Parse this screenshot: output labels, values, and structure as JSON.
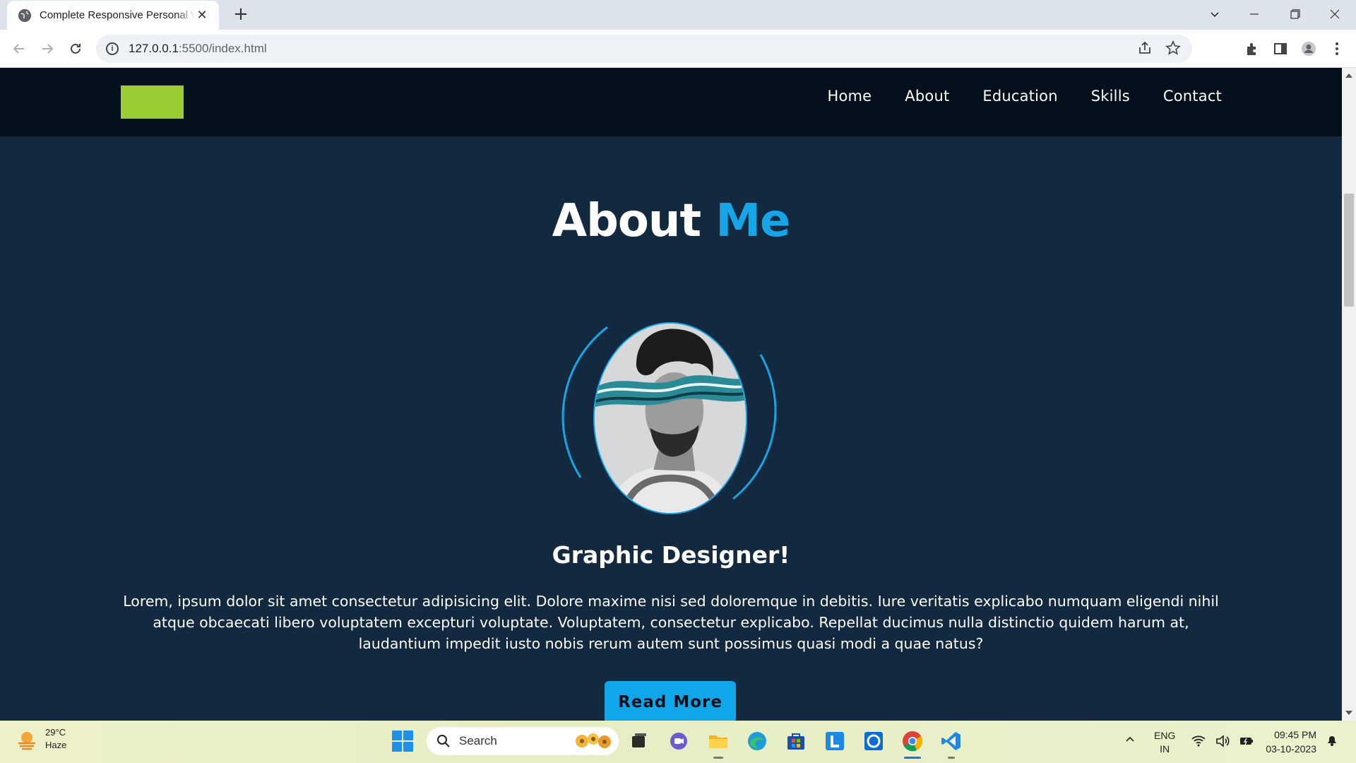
{
  "browser": {
    "tab_title": "Complete Responsive Personal W",
    "url_host": "127.0.0.1",
    "url_rest": ":5500/index.html"
  },
  "site": {
    "nav": [
      "Home",
      "About",
      "Education",
      "Skills",
      "Contact"
    ],
    "heading_main": "About ",
    "heading_accent": "Me",
    "subtitle": "Graphic Designer!",
    "description": "Lorem, ipsum dolor sit amet consectetur adipisicing elit. Dolore maxime nisi sed doloremque in debitis. Iure veritatis explicabo numquam eligendi nihil atque obcaecati libero voluptatem excepturi voluptate. Voluptatem, consectetur explicabo. Repellat ducimus nulla distinctio quidem harum at, laudantium impedit iusto nobis rerum autem sunt possimus quasi modi a quae natus?",
    "button": "Read More",
    "colors": {
      "header_bg": "#04111c",
      "page_bg": "#13293f",
      "accent": "#16a5e6",
      "logo": "#9acd32"
    }
  },
  "taskbar": {
    "weather_temp": "29°C",
    "weather_desc": "Haze",
    "search_label": "Search",
    "lang_line1": "ENG",
    "lang_line2": "IN",
    "time": "09:45 PM",
    "date": "03-10-2023",
    "apps": [
      "task-view-icon",
      "meet-icon",
      "file-explorer-icon",
      "edge-icon",
      "store-icon",
      "l-app-icon",
      "cortana-icon",
      "chrome-icon",
      "vscode-icon"
    ]
  }
}
